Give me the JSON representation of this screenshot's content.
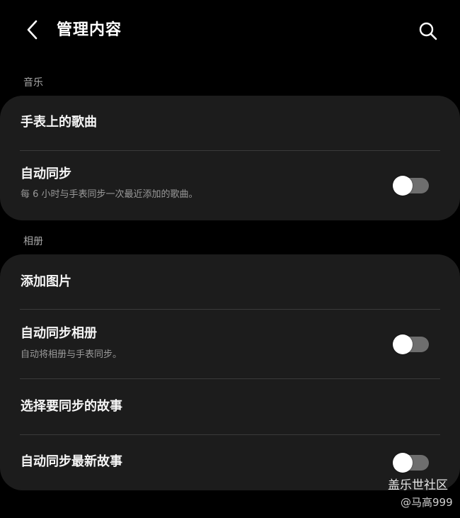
{
  "header": {
    "title": "管理内容",
    "back_icon": "chevron-left-icon",
    "search_icon": "search-icon"
  },
  "music": {
    "label": "音乐",
    "songs_on_watch": "手表上的歌曲",
    "auto_sync": {
      "title": "自动同步",
      "subtitle": "每 6 小时与手表同步一次最近添加的歌曲。",
      "enabled": false
    }
  },
  "album": {
    "label": "相册",
    "add_pictures": "添加图片",
    "auto_sync_album": {
      "title": "自动同步相册",
      "subtitle": "自动将相册与手表同步。",
      "enabled": false
    },
    "choose_stories": "选择要同步的故事",
    "auto_sync_stories": {
      "title": "自动同步最新故事",
      "enabled": false
    }
  },
  "watermark": {
    "site": "盖乐世社区",
    "user": "@马高999"
  },
  "colors": {
    "background": "#000000",
    "card": "#1c1c1c",
    "toggle_off_track": "#6e6e6e",
    "toggle_thumb": "#ffffff"
  }
}
